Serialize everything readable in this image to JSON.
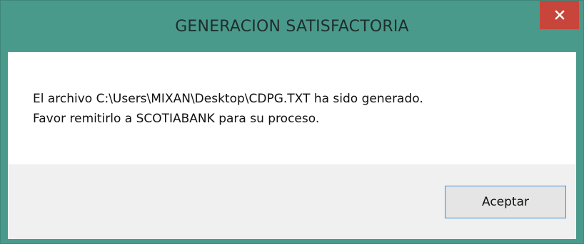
{
  "window": {
    "title": "GENERACION SATISFACTORIA",
    "close_icon": "close-icon",
    "frame_color": "#4a9a8c",
    "close_color": "#c7453b"
  },
  "dialog": {
    "message_line1": "El archivo C:\\Users\\MIXAN\\Desktop\\CDPG.TXT ha sido generado.",
    "message_line2": "Favor remitirlo a SCOTIABANK para su proceso.",
    "accept_label": "Aceptar"
  }
}
